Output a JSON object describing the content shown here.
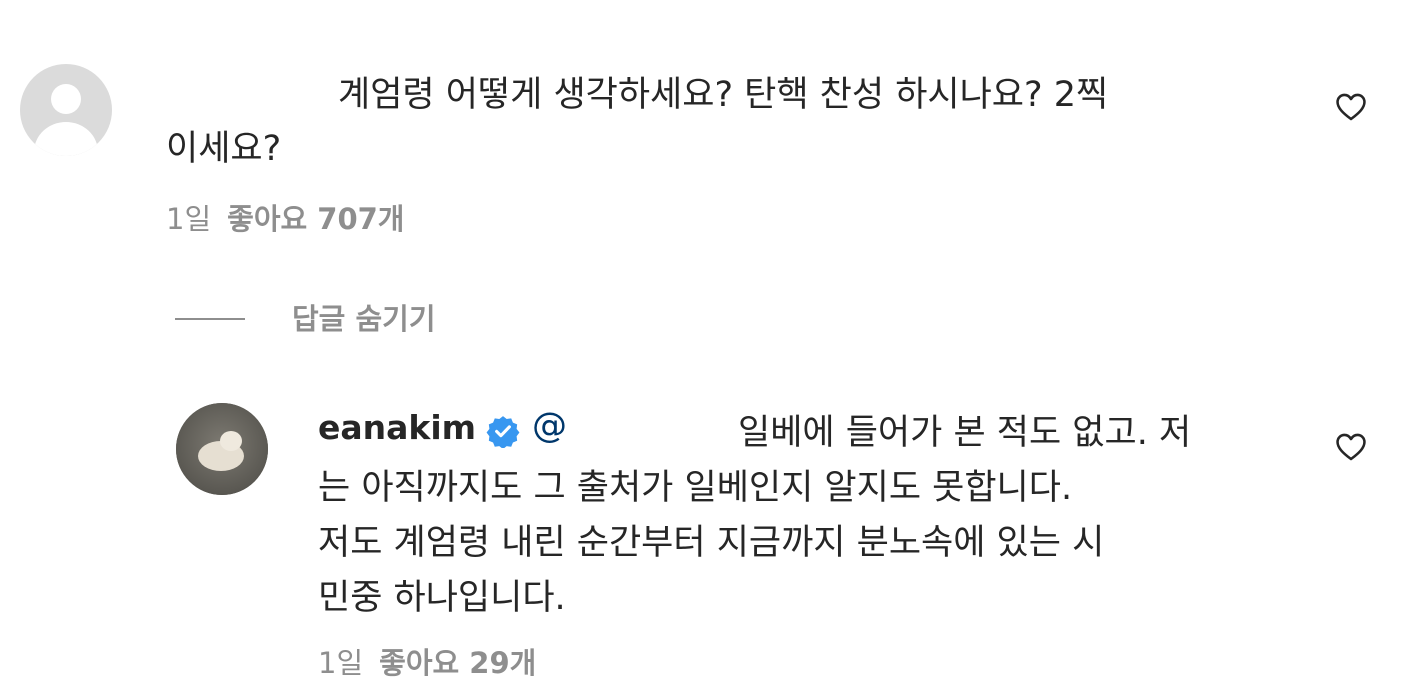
{
  "comment": {
    "text_line1": "계엄령 어떻게 생각하세요? 탄핵 찬성 하시나요? 2찍",
    "text_line2": "이세요?",
    "time": "1일",
    "likes": "좋아요 707개"
  },
  "replies_toggle": {
    "label": "답글 숨기기"
  },
  "reply": {
    "username": "eanakim",
    "mention": "@",
    "text_line1": "일베에 들어가 본 적도 없고. 저",
    "text_line2": "는 아직까지도 그 출처가 일베인지 알지도 못합니다.",
    "text_line3": "저도 계엄령 내린 순간부터 지금까지 분노속에 있는 시",
    "text_line4": "민중 하나입니다.",
    "time": "1일",
    "likes": "좋아요 29개"
  },
  "icons": {
    "heart": "heart-outline-icon",
    "verified": "verified-badge-icon",
    "default_avatar": "default-avatar-icon"
  },
  "colors": {
    "text": "#262626",
    "secondary": "#8e8e8e",
    "mention": "#00376b",
    "verified": "#3897f0"
  }
}
